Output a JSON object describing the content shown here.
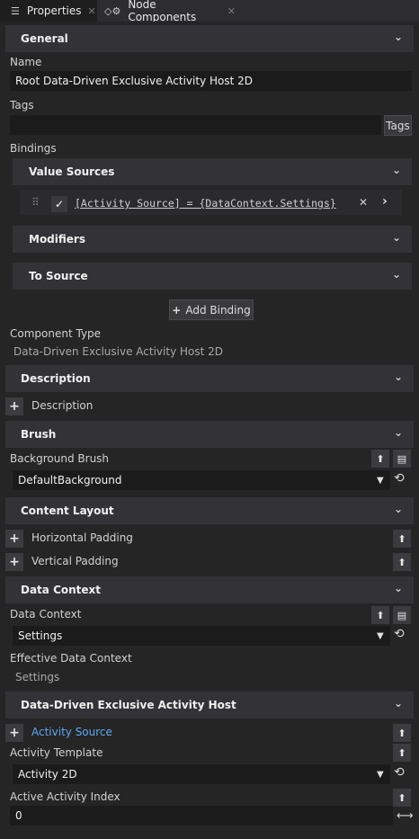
{
  "tabs": [
    {
      "label": "Properties",
      "close": "✕"
    },
    {
      "label": "Node Components",
      "close": "✕"
    }
  ],
  "general": {
    "header": "General",
    "name_label": "Name",
    "name_value": "Root Data-Driven Exclusive Activity Host 2D",
    "tags_label": "Tags",
    "tags_value": "",
    "tags_button": "Tags",
    "bindings_label": "Bindings",
    "value_sources_header": "Value Sources",
    "binding_expr": "[Activity Source] = {DataContext.Settings}",
    "modifiers_header": "Modifiers",
    "to_source_header": "To Source",
    "add_binding": "Add Binding",
    "component_type_label": "Component Type",
    "component_type_value": "Data-Driven Exclusive Activity Host 2D"
  },
  "description": {
    "header": "Description",
    "item": "Description"
  },
  "brush": {
    "header": "Brush",
    "background_label": "Background Brush",
    "background_value": "DefaultBackground"
  },
  "content_layout": {
    "header": "Content Layout",
    "horizontal": "Horizontal Padding",
    "vertical": "Vertical Padding"
  },
  "data_context": {
    "header": "Data Context",
    "label": "Data Context",
    "value": "Settings",
    "effective_label": "Effective Data Context",
    "effective_value": "Settings"
  },
  "host": {
    "header": "Data-Driven Exclusive Activity Host",
    "activity_source": "Activity Source",
    "template_label": "Activity Template",
    "template_value": "Activity 2D",
    "index_label": "Active Activity Index",
    "index_value": "0"
  },
  "colors": {
    "link": "#5ea9f0",
    "panel": "#252526",
    "header": "#333337",
    "field": "#1b1b1c"
  }
}
